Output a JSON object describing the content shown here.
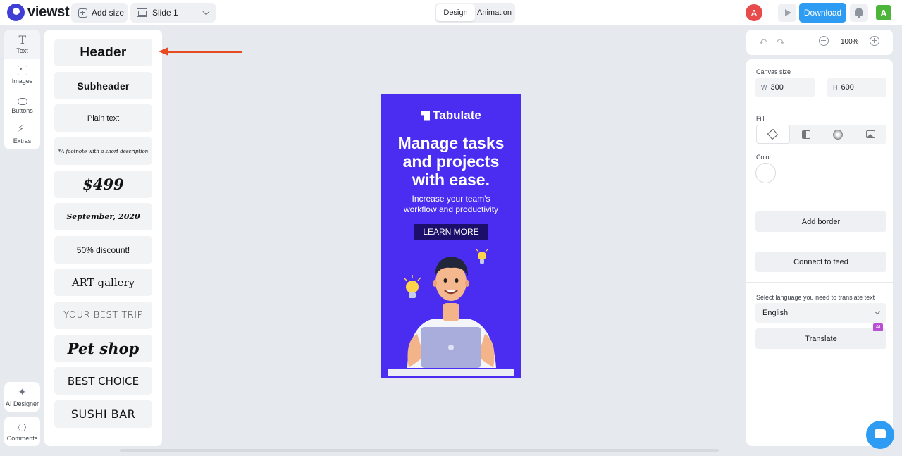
{
  "app": {
    "logo_text": "viewst"
  },
  "topbar": {
    "add_size_label": "Add size",
    "slide_selected": "Slide 1",
    "mode_tabs": [
      {
        "label": "Design",
        "active": true
      },
      {
        "label": "Animation",
        "active": false
      }
    ],
    "avatar_initial": "A",
    "download_label": "Download",
    "user_initial": "A"
  },
  "rail": {
    "items": [
      {
        "label": "Text",
        "icon": "text-icon",
        "active": true
      },
      {
        "label": "Images",
        "icon": "image-icon"
      },
      {
        "label": "Buttons",
        "icon": "button-icon"
      },
      {
        "label": "Extras",
        "icon": "bolt-icon"
      }
    ],
    "ai_designer_label": "AI Designer",
    "comments_label": "Comments"
  },
  "presets": [
    "Header",
    "Subheader",
    "Plain text",
    "*A footnote with a short description",
    "$499",
    "September, 2020",
    "50% discount!",
    "ART gallery",
    "YOUR BEST TRIP",
    "Pet shop",
    "BEST CHOICE",
    "SUSHI BAR"
  ],
  "banner": {
    "brand": "Tabulate",
    "headline_lines": [
      "Manage tasks",
      "and projects",
      "with ease."
    ],
    "sub_lines": [
      "Increase your team's",
      "workflow and productivity"
    ],
    "cta": "LEARN MORE",
    "bg_color": "#4b2df2"
  },
  "right": {
    "zoom": "100%",
    "canvas_size_label": "Canvas size",
    "width_key": "W",
    "width": "300",
    "height_key": "H",
    "height": "600",
    "fill_label": "Fill",
    "color_label": "Color",
    "add_border": "Add border",
    "connect_feed": "Connect to feed",
    "lang_label": "Select language you need to translate text",
    "lang_value": "English",
    "translate": "Translate",
    "ai_badge": "AI"
  },
  "colors": {
    "accent": "#2e9cf2",
    "arrow": "#e84a22"
  }
}
